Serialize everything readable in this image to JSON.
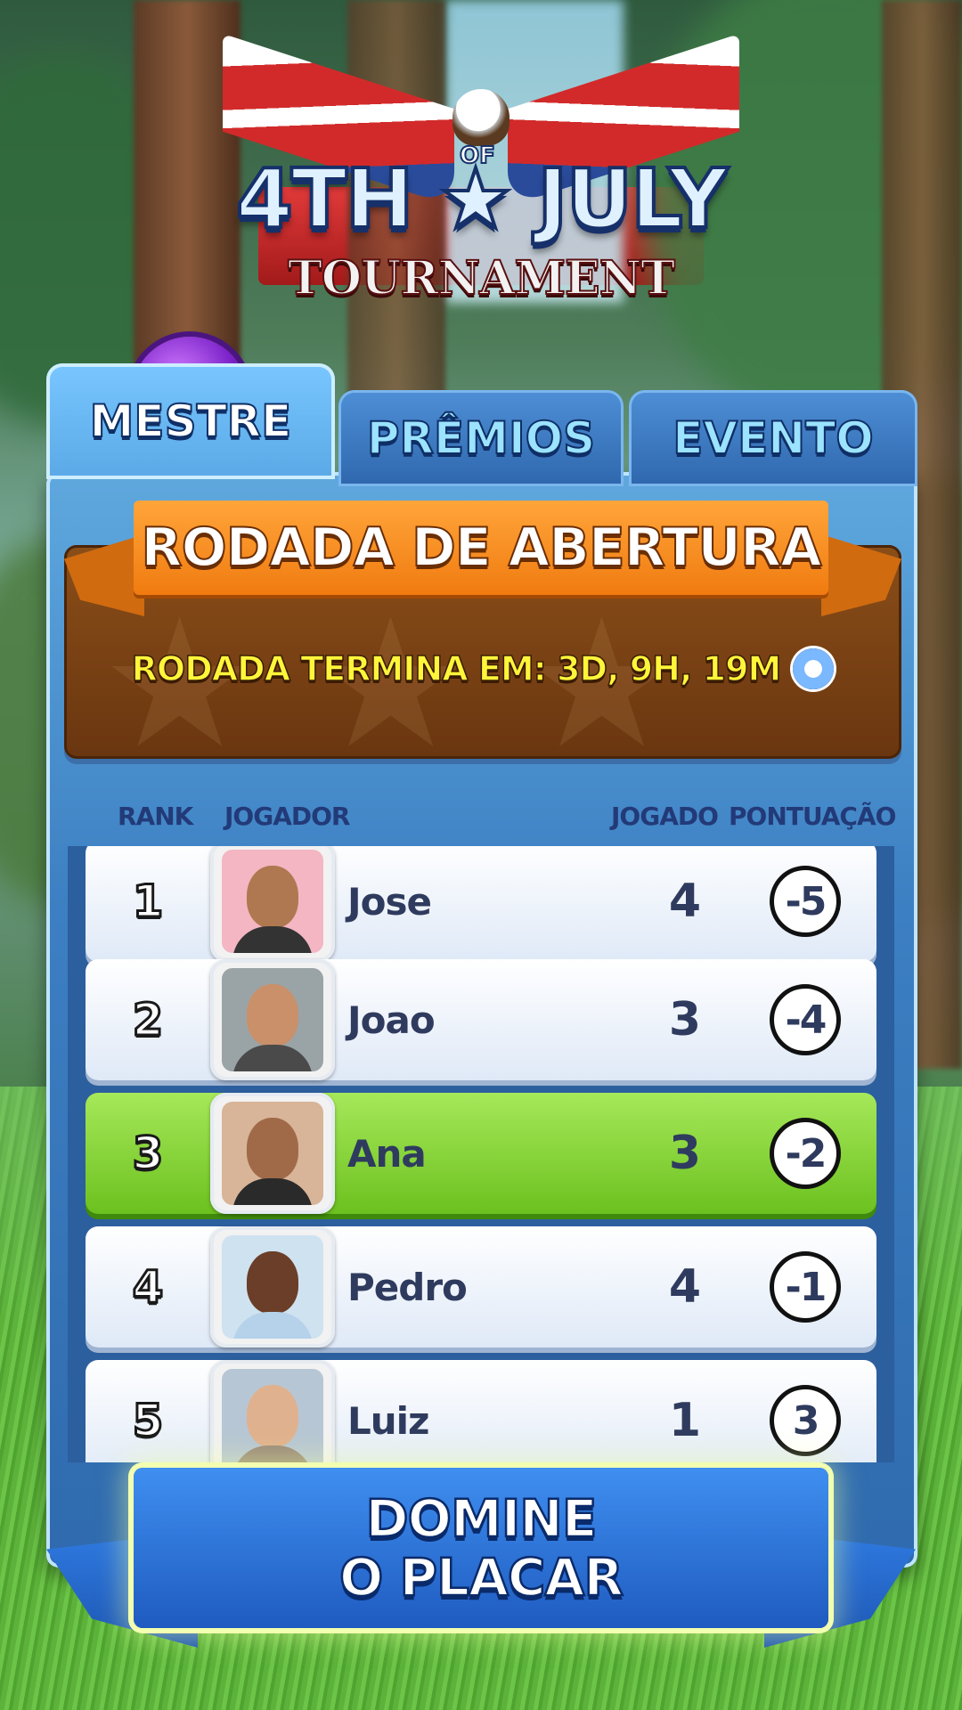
{
  "logo": {
    "title": "4TH",
    "of": "OF",
    "title2": "JULY",
    "subtitle": "TOURNAMENT"
  },
  "tabs": [
    {
      "label": "MESTRE",
      "active": true
    },
    {
      "label": "PRÊMIOS",
      "active": false
    },
    {
      "label": "EVENTO",
      "active": false
    }
  ],
  "round": {
    "title": "RODADA DE ABERTURA",
    "timer_label": "RODADA TERMINA EM: 3D, 9H, 19M",
    "timer_icon": "clock-icon"
  },
  "columns": {
    "rank": "RANK",
    "player": "JOGADOR",
    "played": "JOGADO",
    "score": "PONTUAÇÃO"
  },
  "leaderboard": [
    {
      "rank": "1",
      "name": "Jose",
      "played": "4",
      "score": "-5",
      "highlight": false
    },
    {
      "rank": "2",
      "name": "Joao",
      "played": "3",
      "score": "-4",
      "highlight": false
    },
    {
      "rank": "3",
      "name": "Ana",
      "played": "3",
      "score": "-2",
      "highlight": true
    },
    {
      "rank": "4",
      "name": "Pedro",
      "played": "4",
      "score": "-1",
      "highlight": false
    },
    {
      "rank": "5",
      "name": "Luiz",
      "played": "1",
      "score": "3",
      "highlight": false
    }
  ],
  "cta": {
    "line1": "DOMINE",
    "line2": "O PLACAR"
  },
  "colors": {
    "panel": "#3c7fc2",
    "highlight_row": "#6cc11f",
    "ribbon": "#f07b10",
    "timer_text": "#fff53a"
  }
}
